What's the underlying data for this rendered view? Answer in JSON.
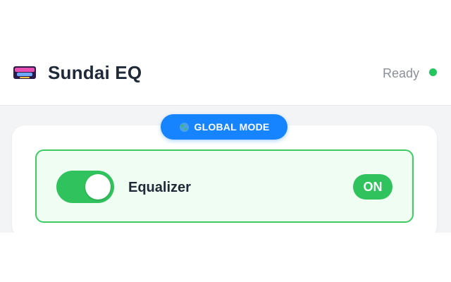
{
  "header": {
    "title": "Sundai EQ",
    "logo": "sundai-logo",
    "status": {
      "text": "Ready",
      "color": "#22c55e"
    }
  },
  "mode_badge": {
    "icon": "globe-icon",
    "label": "GLOBAL MODE",
    "color": "#1684ff"
  },
  "equalizer": {
    "label": "Equalizer",
    "enabled": true,
    "state_label": "ON",
    "accent": "#30c25c"
  }
}
